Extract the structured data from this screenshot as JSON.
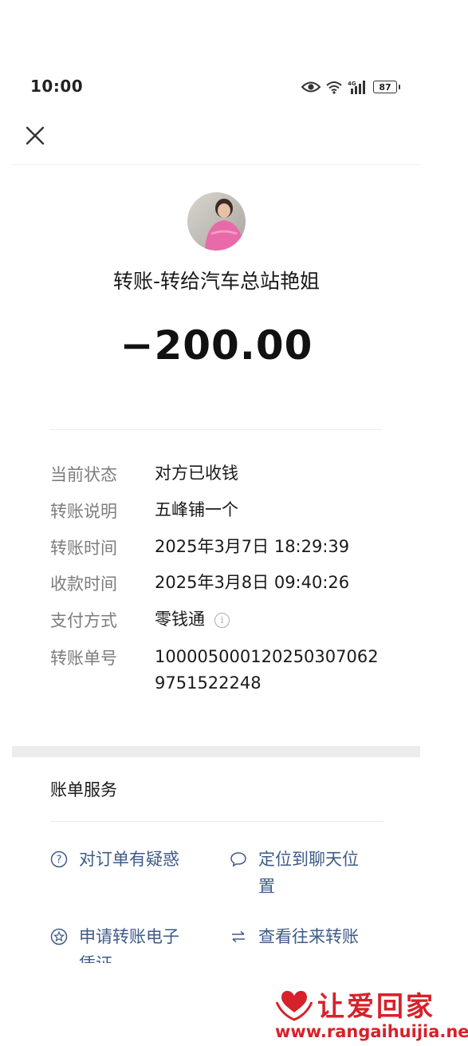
{
  "status_bar": {
    "time": "10:00",
    "battery": "87"
  },
  "header": {
    "close_icon": "close-icon"
  },
  "transfer": {
    "title": "转账-转给汽车总站艳姐",
    "amount": "−200.00"
  },
  "details": [
    {
      "label": "当前状态",
      "value": "对方已收钱"
    },
    {
      "label": "转账说明",
      "value": "五峰铺一个"
    },
    {
      "label": "转账时间",
      "value": "2025年3月7日 18:29:39"
    },
    {
      "label": "收款时间",
      "value": "2025年3月8日 09:40:26"
    },
    {
      "label": "支付方式",
      "value": "零钱通"
    },
    {
      "label": "转账单号",
      "value_line1": "1000050001202503070629",
      "value_line2": "751522248",
      "value_line1_display": "10000500012025030706 2",
      "value": "100005000120250307062"
    }
  ],
  "order_no": {
    "line1": "100005000120250307062",
    "line2": "9751522248"
  },
  "bill_services": {
    "title": "账单服务",
    "items": [
      {
        "label_line1": "对订单有疑惑",
        "icon": "question-icon"
      },
      {
        "label_line1": "定位到聊天位",
        "label_line2": "置",
        "icon": "chat-bubble-icon"
      },
      {
        "label_line1": "申请转账电子",
        "label_line2": "凭证",
        "icon": "star-badge-icon"
      },
      {
        "label_line1": "查看往来转账",
        "icon": "swap-arrows-icon"
      }
    ]
  },
  "watermark": {
    "text": "让爱回家",
    "url": "www.rangaihuijia.net"
  },
  "colors": {
    "link": "#3f5b88",
    "label_grey": "#7d7d7d",
    "watermark_red": "#d6222a"
  }
}
